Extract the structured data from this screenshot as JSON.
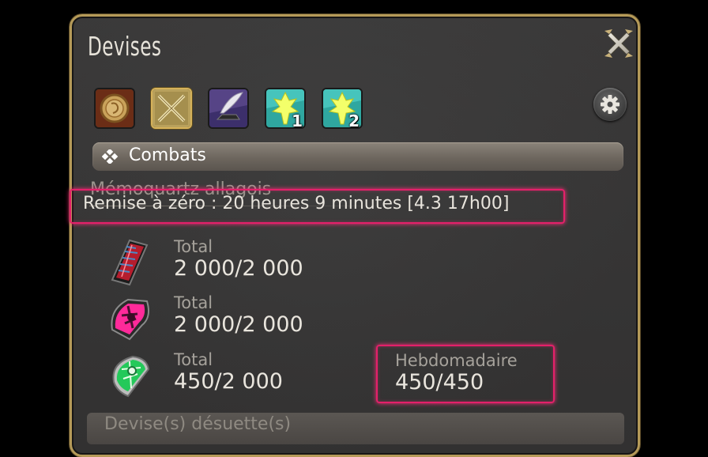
{
  "window": {
    "title": "Devises"
  },
  "tabs": [
    {
      "name": "gil-coin-icon"
    },
    {
      "name": "crossed-swords-icon",
      "active": true
    },
    {
      "name": "quill-anvil-icon"
    },
    {
      "name": "tomestone-1-icon",
      "number": "1"
    },
    {
      "name": "tomestone-2-icon",
      "number": "2"
    }
  ],
  "section": {
    "label": "Combats"
  },
  "subsection": {
    "title": "Mémoquartz allagois"
  },
  "reset": {
    "text": "Remise à zéro : 20 heures 9 minutes [4.3 17h00]"
  },
  "currencies": [
    {
      "icon": "red-tomestone-icon",
      "label": "Total",
      "value": "2 000/2 000"
    },
    {
      "icon": "pink-tomestone-icon",
      "label": "Total",
      "value": "2 000/2 000"
    },
    {
      "icon": "green-tomestone-icon",
      "label": "Total",
      "value": "450/2 000",
      "weekly_label": "Hebdomadaire",
      "weekly_value": "450/450"
    }
  ],
  "obsolete": {
    "label": "Devise(s) désuette(s)"
  },
  "colors": {
    "frame": "#b59a58",
    "highlight": "#e4206a",
    "background": "#353434"
  }
}
